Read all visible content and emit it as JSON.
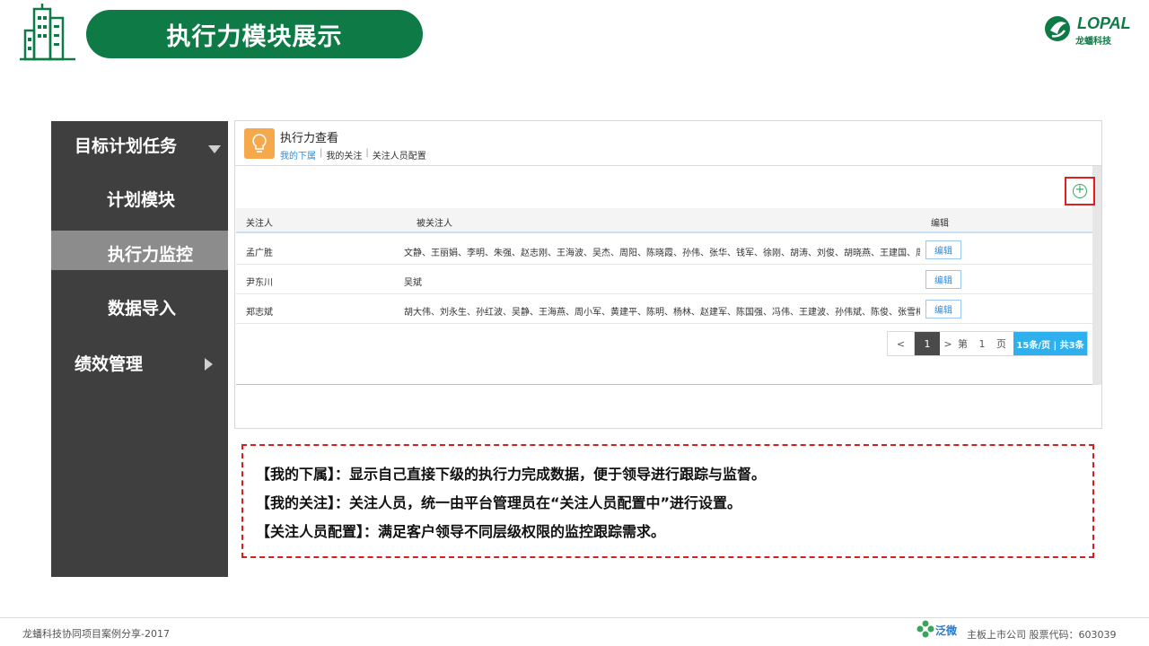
{
  "header": {
    "title": "执行力模块展示",
    "logo_text": "LOPAL",
    "logo_sub": "龙蟠科技",
    "brand_color": "#0e7a46"
  },
  "sidebar": {
    "items": [
      {
        "label": "目标计划任务",
        "icon": "chevron-down-icon"
      },
      {
        "label": "计划模块"
      },
      {
        "label": "执行力监控",
        "active": true
      },
      {
        "label": "数据导入"
      },
      {
        "label": "绩效管理",
        "icon": "chevron-right-icon"
      }
    ]
  },
  "app": {
    "title": "执行力查看",
    "tabs": [
      "我的下属",
      "我的关注",
      "关注人员配置"
    ],
    "active_tab": "我的下属",
    "table": {
      "headers": [
        "关注人",
        "被关注人",
        "编辑"
      ],
      "rows": [
        {
          "watcher": "孟广胜",
          "watched": "文静、王丽娟、李明、朱强、赵志刚、王海波、吴杰、周阳、陈晓霞、孙伟、张华、钱军、徐刚、胡涛、刘俊、胡晓燕、王建国、周小波",
          "edit": "编辑"
        },
        {
          "watcher": "尹东川",
          "watched": "吴斌",
          "edit": "编辑"
        },
        {
          "watcher": "郑志斌",
          "watched": "胡大伟、刘永生、孙红波、吴静、王海燕、周小军、黄建平、陈明、杨林、赵建军、陈国强、冯伟、王建波、孙伟斌、陈俊、张雪梅、周光明、陈俊宇",
          "edit": "编辑"
        }
      ]
    },
    "pager": {
      "prev": "<",
      "current": "1",
      "next": ">",
      "page_prefix": "第",
      "page_number": "1",
      "page_suffix": "页",
      "size_info": "15条/页 | 共3条"
    }
  },
  "description": {
    "lines": [
      "【我的下属】：显示自己直接下级的执行力完成数据，便于领导进行跟踪与监督。",
      "【我的关注】：关注人员，统一由平台管理员在“关注人员配置中”进行设置。",
      "【关注人员配置】：满足客户领导不同层级权限的监控跟踪需求。"
    ]
  },
  "footer": {
    "left": "龙蟠科技协同项目案例分享-2017",
    "logo_text": "泛微",
    "right": "主板上市公司  股票代码：603039"
  }
}
